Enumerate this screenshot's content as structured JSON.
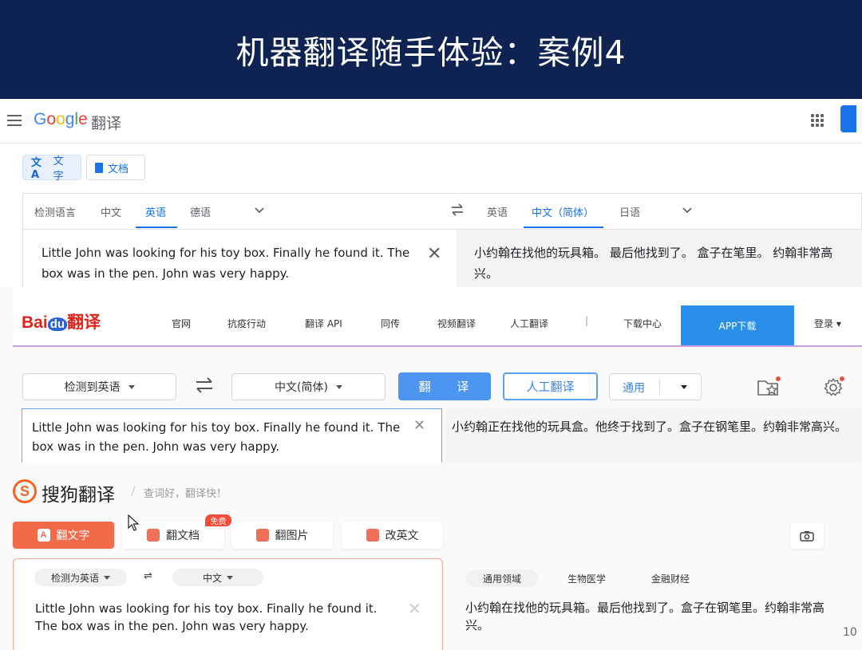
{
  "slide": {
    "title": "机器翻译随手体验：案例4",
    "page_number": "10"
  },
  "google": {
    "logo": [
      "G",
      "o",
      "o",
      "g",
      "l",
      "e"
    ],
    "logo_colors": [
      "#4285f4",
      "#ea4335",
      "#fbbc05",
      "#4285f4",
      "#34a853",
      "#ea4335"
    ],
    "product": "翻译",
    "modes": [
      {
        "label": "文字",
        "icon": "translate-icon",
        "selected": true
      },
      {
        "label": "文档",
        "icon": "document-icon",
        "selected": false
      }
    ],
    "source_langs": [
      "检测语言",
      "中文",
      "英语",
      "德语"
    ],
    "source_selected": "英语",
    "target_langs": [
      "英语",
      "中文（简体）",
      "日语"
    ],
    "target_selected": "中文（简体）",
    "source_text": "Little John was looking for his toy box. Finally he found it. The box was in the pen. John was very happy.",
    "target_text": "小约翰在找他的玩具箱。 最后他找到了。 盒子在笔里。 约翰非常高兴。"
  },
  "baidu": {
    "logo_bai": "Bai",
    "logo_du": "du",
    "logo_fanyi": "翻译",
    "nav": [
      "官网",
      "抗疫行动",
      "翻译 API",
      "同传",
      "视频翻译",
      "人工翻译",
      "|",
      "下载中心"
    ],
    "app_download": "APP下载",
    "login": "登录",
    "source_lang": "检测到英语",
    "target_lang": "中文(简体)",
    "translate_button": "翻 译",
    "human_button": "人工翻译",
    "domain": "通用",
    "source_text": "Little John was looking for his toy box. Finally he found it. The box was in the pen. John was very happy.",
    "target_text": "小约翰正在找他的玩具盒。他终于找到了。盒子在钢笔里。约翰非常高兴。",
    "brand_blue": "#2a8fe8"
  },
  "sogou": {
    "logo_letter": "S",
    "logo_text": "搜狗翻译",
    "slogan": "查词好，翻译快！",
    "tabs": [
      "翻文字",
      "翻文档",
      "翻图片",
      "改英文"
    ],
    "free_badge": "免费",
    "source_lang": "检测为英语",
    "target_lang": "中文",
    "domains": [
      "通用领域",
      "生物医学",
      "金融财经"
    ],
    "source_text": "Little John was looking for his toy box. Finally he found it. The box was in the pen. John was very happy.",
    "target_text": "小约翰在找他的玩具箱。最后他找到了。盒子在钢笔里。约翰非常高兴。",
    "accent": "#f26a4a"
  }
}
